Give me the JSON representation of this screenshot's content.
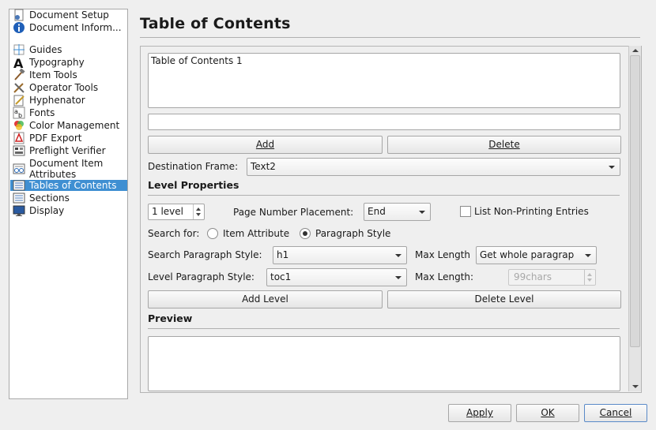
{
  "sidebar": {
    "items": [
      {
        "label": "Document Setup",
        "icon": "document-setup-icon"
      },
      {
        "label": "Document Inform...",
        "icon": "info-icon"
      },
      {
        "label": "Guides",
        "icon": "guides-icon"
      },
      {
        "label": "Typography",
        "icon": "typography-icon"
      },
      {
        "label": "Item Tools",
        "icon": "item-tools-icon"
      },
      {
        "label": "Operator Tools",
        "icon": "operator-tools-icon"
      },
      {
        "label": "Hyphenator",
        "icon": "hyphenator-icon"
      },
      {
        "label": "Fonts",
        "icon": "fonts-icon"
      },
      {
        "label": "Color Management",
        "icon": "color-management-icon"
      },
      {
        "label": "PDF Export",
        "icon": "pdf-export-icon"
      },
      {
        "label": "Preflight Verifier",
        "icon": "preflight-verifier-icon"
      },
      {
        "label_line1": "Document Item",
        "label_line2": "Attributes",
        "icon": "document-item-attributes-icon"
      },
      {
        "label": "Tables of Contents",
        "icon": "tables-of-contents-icon",
        "selected": true
      },
      {
        "label": "Sections",
        "icon": "sections-icon"
      },
      {
        "label": "Display",
        "icon": "display-icon"
      }
    ]
  },
  "page": {
    "title": "Table of Contents"
  },
  "toc": {
    "list_items": [
      "Table of Contents 1"
    ],
    "name_field_value": "",
    "add_label": "Add",
    "delete_label": "Delete",
    "destination_frame_label": "Destination Frame:",
    "destination_frame_value": "Text2"
  },
  "level_properties": {
    "section_label": "Level Properties",
    "level_value": "1 level",
    "page_number_placement_label": "Page Number Placement:",
    "page_number_placement_value": "End",
    "list_non_printing_label": "List Non-Printing Entries",
    "list_non_printing_checked": false,
    "search_for_label": "Search for:",
    "item_attribute_label": "Item Attribute",
    "paragraph_style_label": "Paragraph Style",
    "search_for_selected": "Paragraph Style",
    "search_paragraph_style_label": "Search Paragraph Style:",
    "search_paragraph_style_value": "h1",
    "max_length_label": "Max Length",
    "max_length_value": "Get whole paragrap",
    "level_paragraph_style_label": "Level Paragraph Style:",
    "level_paragraph_style_value": "toc1",
    "max_length2_label": "Max Length:",
    "max_length2_value": "99chars",
    "add_level_label": "Add Level",
    "delete_level_label": "Delete Level"
  },
  "preview": {
    "section_label": "Preview",
    "content": ""
  },
  "footer": {
    "apply_label": "Apply",
    "ok_label": "OK",
    "cancel_label": "Cancel"
  },
  "colors": {
    "selection": "#3f8fd2",
    "background": "#efefef"
  }
}
